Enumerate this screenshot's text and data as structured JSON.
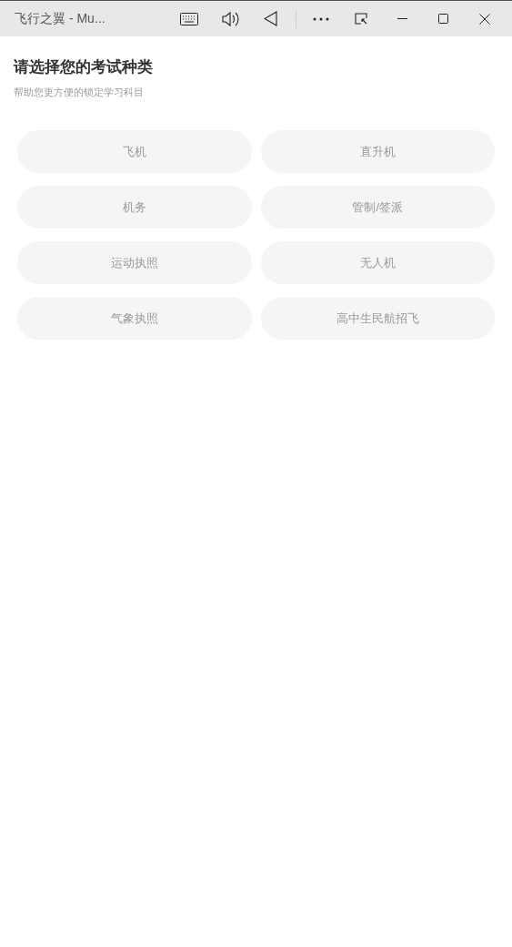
{
  "window": {
    "title": "飞行之翼 - Mu..."
  },
  "heading": "请选择您的考试种类",
  "subheading": "帮助您更方便的锁定学习科目",
  "options": [
    {
      "label": "飞机"
    },
    {
      "label": "直升机"
    },
    {
      "label": "机务"
    },
    {
      "label": "管制/签派"
    },
    {
      "label": "运动执照"
    },
    {
      "label": "无人机"
    },
    {
      "label": "气象执照"
    },
    {
      "label": "高中生民航招飞"
    }
  ]
}
